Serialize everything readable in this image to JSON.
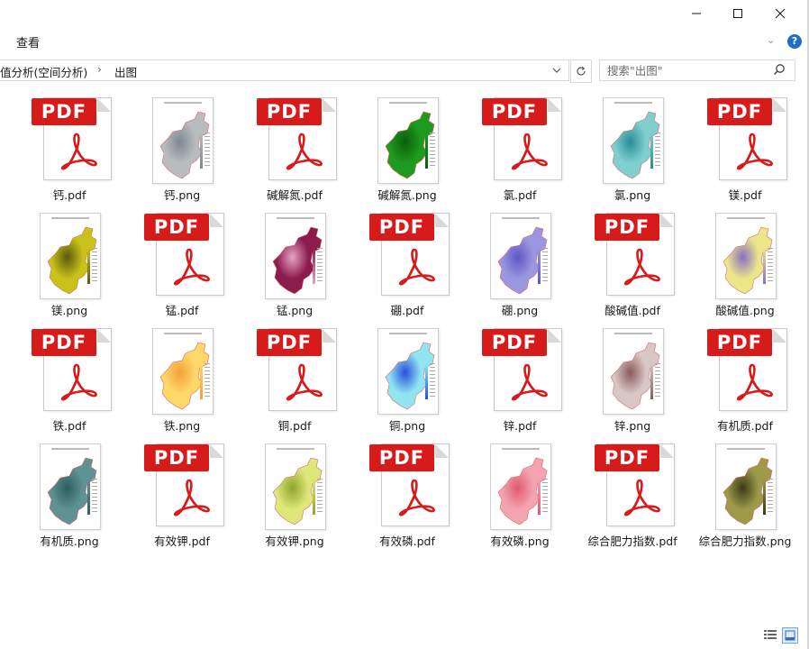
{
  "window": {
    "controls": {
      "minimize_icon": "minimize-icon",
      "maximize_icon": "maximize-icon",
      "close_icon": "close-icon"
    }
  },
  "ribbon": {
    "tab_view": "查看",
    "collapse_icon": "chevron-down-icon",
    "help": "?"
  },
  "address": {
    "parent": "值分析(空间分析)",
    "separator": "›",
    "current": "出图"
  },
  "search": {
    "placeholder": "搜索\"出图\""
  },
  "files": [
    {
      "name": "钙.pdf",
      "type": "pdf"
    },
    {
      "name": "钙.png",
      "type": "png",
      "color": "#b8bcbf",
      "accent": "#7e8890"
    },
    {
      "name": "碱解氮.pdf",
      "type": "pdf"
    },
    {
      "name": "碱解氮.png",
      "type": "png",
      "color": "#1e9a1e",
      "accent": "#0b5e0b"
    },
    {
      "name": "氯.pdf",
      "type": "pdf"
    },
    {
      "name": "氯.png",
      "type": "png",
      "color": "#7fcfcf",
      "accent": "#2a8d95"
    },
    {
      "name": "镁.pdf",
      "type": "pdf"
    },
    {
      "name": "镁.png",
      "type": "png",
      "color": "#c9c21a",
      "accent": "#5a5a10"
    },
    {
      "name": "锰.pdf",
      "type": "pdf"
    },
    {
      "name": "锰.png",
      "type": "png",
      "color": "#8c1c4e",
      "accent": "#e7a3c4"
    },
    {
      "name": "硼.pdf",
      "type": "pdf"
    },
    {
      "name": "硼.png",
      "type": "png",
      "color": "#9a97e0",
      "accent": "#5b57c4"
    },
    {
      "name": "酸碱值.pdf",
      "type": "pdf"
    },
    {
      "name": "酸碱值.png",
      "type": "png",
      "color": "#ece68a",
      "accent": "#8a6fc2"
    },
    {
      "name": "铁.pdf",
      "type": "pdf"
    },
    {
      "name": "铁.png",
      "type": "png",
      "color": "#ffd86a",
      "accent": "#f0a23a"
    },
    {
      "name": "铜.pdf",
      "type": "pdf"
    },
    {
      "name": "铜.png",
      "type": "png",
      "color": "#8fe6f0",
      "accent": "#2a4fe0"
    },
    {
      "name": "锌.pdf",
      "type": "pdf"
    },
    {
      "name": "锌.png",
      "type": "png",
      "color": "#d9c7c7",
      "accent": "#8a5a5a"
    },
    {
      "name": "有机质.pdf",
      "type": "pdf"
    },
    {
      "name": "有机质.png",
      "type": "png",
      "color": "#5f9292",
      "accent": "#2e5e5e"
    },
    {
      "name": "有效钾.pdf",
      "type": "pdf"
    },
    {
      "name": "有效钾.png",
      "type": "png",
      "color": "#dde77a",
      "accent": "#8fa42a"
    },
    {
      "name": "有效磷.pdf",
      "type": "pdf"
    },
    {
      "name": "有效磷.png",
      "type": "png",
      "color": "#f3a4b0",
      "accent": "#e05a6e"
    },
    {
      "name": "综合肥力指数.pdf",
      "type": "pdf"
    },
    {
      "name": "综合肥力指数.png",
      "type": "png",
      "color": "#9d9a4a",
      "accent": "#3c3a14"
    }
  ],
  "statusbar": {
    "details_view_icon": "details-view-icon",
    "large_icons_view_icon": "large-icons-view-icon"
  },
  "colors": {
    "pdf_red": "#d71b1b",
    "help_blue": "#1f6fc5"
  }
}
